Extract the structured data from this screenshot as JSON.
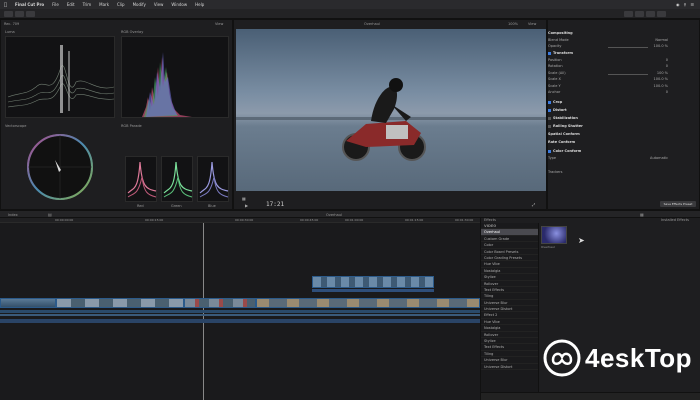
{
  "menubar": {
    "app_name": "Final Cut Pro",
    "items": [
      "File",
      "Edit",
      "Trim",
      "Mark",
      "Clip",
      "Modify",
      "View",
      "Window",
      "Help"
    ]
  },
  "scopes": {
    "title": "Rec. 709",
    "view_label": "View",
    "waveform_label": "Luma",
    "histogram_label": "RGB Overlay",
    "vectorscope_label": "Vectorscope",
    "parade_label": "RGB Parade",
    "parade_bottoms": [
      "Red",
      "Green",
      "Blue"
    ]
  },
  "viewer": {
    "clip_name": "Overhaul",
    "zoom": "100%",
    "view_label": "View",
    "timecode": "17:21"
  },
  "inspector": {
    "title": "Compositing",
    "rows": [
      {
        "label": "Blend Mode",
        "value": "Normal"
      },
      {
        "label": "Opacity",
        "value": "100.0 %"
      }
    ],
    "transform_title": "Transform",
    "transform_rows": [
      {
        "label": "Position",
        "value": "0"
      },
      {
        "label": "Rotation",
        "value": "0"
      },
      {
        "label": "Scale (All)",
        "value": "100 %"
      },
      {
        "label": "Scale X",
        "value": "100.0 %"
      },
      {
        "label": "Scale Y",
        "value": "100.0 %"
      },
      {
        "label": "Anchor",
        "value": "0"
      }
    ],
    "sections": [
      "Crop",
      "Distort",
      "Stabilization",
      "Rolling Shutter",
      "Spatial Conform",
      "Rate Conform"
    ],
    "color_title": "Color Conform",
    "color_rows": [
      {
        "label": "Type",
        "value": "Automatic"
      },
      {
        "label": "Trackers",
        "value": ""
      }
    ],
    "save_button": "Save Effects Preset"
  },
  "timeline": {
    "index_label": "Index",
    "project_name": "Overhaul",
    "ruler_ticks": [
      "00:00:00:00",
      "00:00:15:00",
      "00:00:30:00",
      "00:00:45:00",
      "00:01:00:00",
      "00:01:15:00",
      "00:01:30:00"
    ]
  },
  "effects": {
    "title": "Effects",
    "installed_label": "Installed Effects",
    "category_header": "VIDEO",
    "items": [
      "Overhaul",
      "Custom Grade",
      "Color",
      "Color Board Presets",
      "Color Grading Presets",
      "Hue Vibe",
      "Nostalgia",
      "Stylize",
      "Rollover",
      "Text Effects",
      "Tiling",
      "Universe Blur",
      "Universe Distort",
      "Effect 2",
      "Hue Vibe",
      "Nostalgia",
      "Rollover",
      "Stylize",
      "Text Effects",
      "Tiling",
      "Universe Blur",
      "Universe Distort"
    ],
    "thumbnail_label": "Overhaul"
  },
  "watermark": {
    "text": "4eskTop"
  }
}
